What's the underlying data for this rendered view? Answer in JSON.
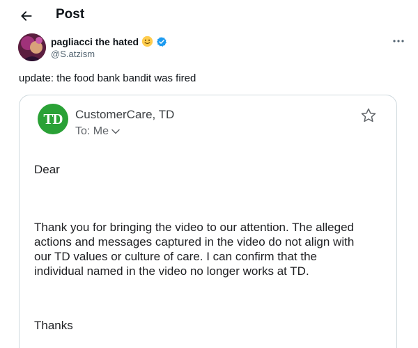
{
  "header": {
    "title": "Post",
    "back_icon": "arrow-left-icon"
  },
  "post": {
    "author": {
      "display_name": "pagliacci the hated",
      "handle": "@S.atzism",
      "emoji_icon": "smiling-face-emoji-icon",
      "verified_icon": "verified-badge-icon",
      "verified_color": "#1d9bf0"
    },
    "more_icon": "more-horizontal-icon",
    "text": "update: the food bank bandit was fired"
  },
  "email": {
    "logo_text": "TD",
    "logo_color": "#2aa136",
    "sender": "CustomerCare, TD",
    "to": "To: Me",
    "to_icon": "chevron-down-icon",
    "star_icon": "star-outline-icon",
    "greeting": "Dear",
    "body_lines": [
      "Thank you for bringing the video to our attention. The alleged",
      "actions and messages captured in the video do not align with",
      "our TD values or culture of care. I can confirm that the",
      "individual named in the video no longer works at TD."
    ],
    "closing": "Thanks"
  }
}
